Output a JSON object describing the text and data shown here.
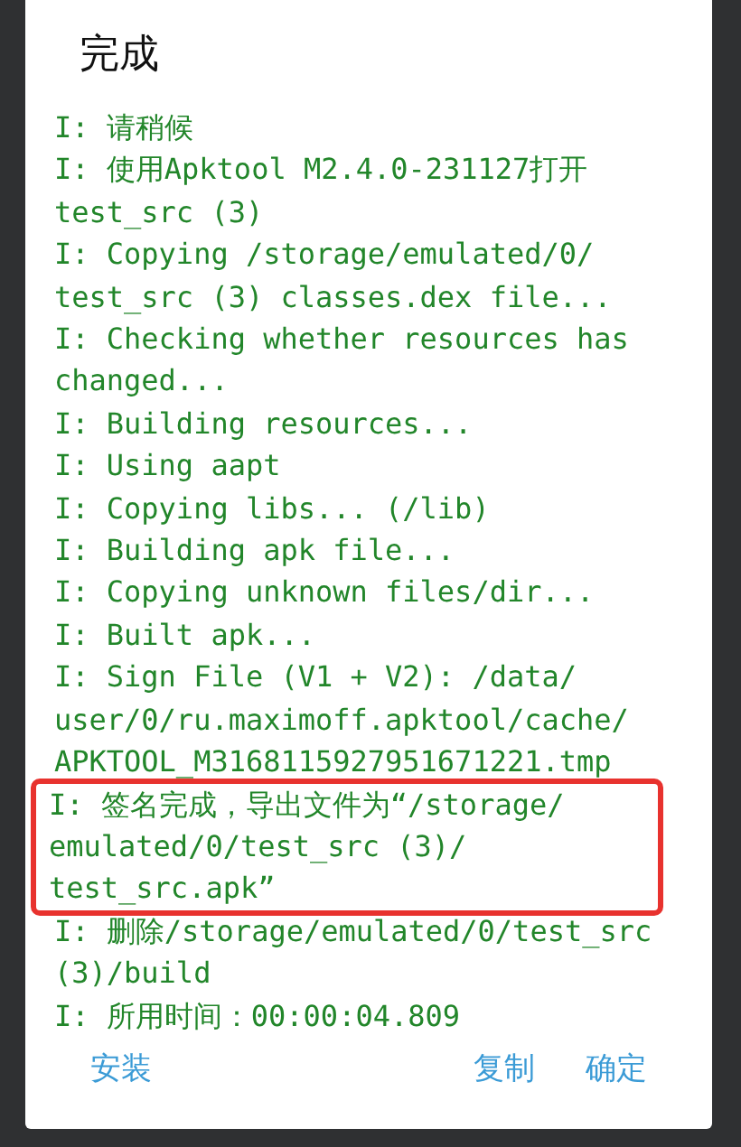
{
  "dialog": {
    "title": "完成",
    "log": [
      {
        "lines": [
          "I: 请稍候"
        ],
        "highlighted": false
      },
      {
        "lines": [
          "I: 使用Apktool M2.4.0-231127打开",
          "test_src (3)"
        ],
        "highlighted": false
      },
      {
        "lines": [
          "I: Copying /storage/emulated/0/",
          "test_src (3) classes.dex file..."
        ],
        "highlighted": false
      },
      {
        "lines": [
          "I: Checking whether resources has",
          "changed..."
        ],
        "highlighted": false
      },
      {
        "lines": [
          "I: Building resources..."
        ],
        "highlighted": false
      },
      {
        "lines": [
          "I: Using aapt"
        ],
        "highlighted": false
      },
      {
        "lines": [
          "I: Copying libs... (/lib)"
        ],
        "highlighted": false
      },
      {
        "lines": [
          "I: Building apk file..."
        ],
        "highlighted": false
      },
      {
        "lines": [
          "I: Copying unknown files/dir..."
        ],
        "highlighted": false
      },
      {
        "lines": [
          "I: Built apk..."
        ],
        "highlighted": false
      },
      {
        "lines": [
          "I: Sign File (V1 + V2): /data/",
          "user/0/ru.maximoff.apktool/cache/",
          "APKTOOL_M3168115927951671221.tmp"
        ],
        "highlighted": false
      },
      {
        "lines": [
          "I: 签名完成，导出文件为“/storage/",
          "emulated/0/test_src (3)/",
          "test_src.apk”"
        ],
        "highlighted": true
      },
      {
        "lines": [
          "I: 删除/storage/emulated/0/test_src",
          "(3)/build"
        ],
        "highlighted": false
      },
      {
        "lines": [
          "I: 所用时间：00:00:04.809"
        ],
        "highlighted": false
      }
    ],
    "buttons": [
      {
        "label": "安装",
        "kind": "left"
      },
      {
        "label": "复制",
        "kind": "right"
      },
      {
        "label": "确定",
        "kind": "right"
      }
    ]
  }
}
